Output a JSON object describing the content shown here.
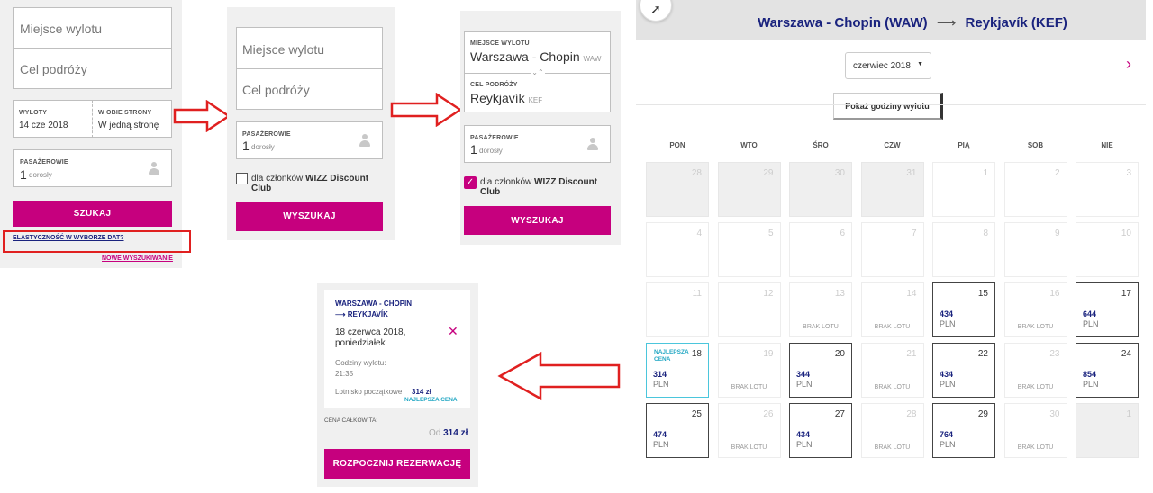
{
  "panel1": {
    "departure_placeholder": "Miejsce wylotu",
    "destination_placeholder": "Cel podróży",
    "departure_label": "WYLOTY",
    "departure_value": "14 cze 2018",
    "return_label": "W OBIE STRONY",
    "return_value": "W jedną stronę",
    "passengers_label": "PASAŻEROWIE",
    "passengers_count": "1",
    "passengers_unit": "dorosły",
    "search_button": "SZUKAJ",
    "flex_dates_link": "ELASTYCZNOŚĆ W WYBORZE DAT?",
    "new_search_link": "NOWE WYSZUKIWANIE"
  },
  "panel2": {
    "departure_placeholder": "Miejsce wylotu",
    "destination_placeholder": "Cel podróży",
    "passengers_label": "PASAŻEROWIE",
    "passengers_count": "1",
    "passengers_unit": "dorosły",
    "club_prefix": "dla członków ",
    "club_name": "WIZZ Discount Club",
    "search_button": "WYSZUKAJ"
  },
  "panel3": {
    "departure_label": "MIEJSCE WYLOTU",
    "departure_city": "Warszawa - Chopin",
    "departure_code": "WAW",
    "destination_label": "CEL PODRÓŻY",
    "destination_city": "Reykjavík",
    "destination_code": "KEF",
    "passengers_label": "PASAŻEROWIE",
    "passengers_count": "1",
    "passengers_unit": "dorosły",
    "club_prefix": "dla członków ",
    "club_name_1": "WIZZ Discount",
    "club_name_2": "Club",
    "club_checked": true,
    "search_button": "WYSZUKAJ"
  },
  "calendar": {
    "route_from": "Warszawa - Chopin (WAW)",
    "route_arrow": "⟶",
    "route_to": "Reykjavík (KEF)",
    "month_select": "czerwiec 2018",
    "show_times_button": "Pokaż godziny wylotu",
    "weekdays": [
      "PON",
      "WTO",
      "ŚRO",
      "CZW",
      "PIĄ",
      "SOB",
      "NIE"
    ],
    "no_flight": "BRAK LOTU",
    "best_price_label": "NAJLEPSZA CENA",
    "currency": "PLN",
    "days": [
      {
        "d": "28",
        "state": "past"
      },
      {
        "d": "29",
        "state": "past"
      },
      {
        "d": "30",
        "state": "past"
      },
      {
        "d": "31",
        "state": "past"
      },
      {
        "d": "1",
        "state": "off"
      },
      {
        "d": "2",
        "state": "off"
      },
      {
        "d": "3",
        "state": "off"
      },
      {
        "d": "4",
        "state": "off"
      },
      {
        "d": "5",
        "state": "off"
      },
      {
        "d": "6",
        "state": "off"
      },
      {
        "d": "7",
        "state": "off"
      },
      {
        "d": "8",
        "state": "off"
      },
      {
        "d": "9",
        "state": "off"
      },
      {
        "d": "10",
        "state": "off"
      },
      {
        "d": "11",
        "state": "off"
      },
      {
        "d": "12",
        "state": "off"
      },
      {
        "d": "13",
        "state": "nf"
      },
      {
        "d": "14",
        "state": "nf"
      },
      {
        "d": "15",
        "state": "avail",
        "price": "434"
      },
      {
        "d": "16",
        "state": "nf"
      },
      {
        "d": "17",
        "state": "avail",
        "price": "644"
      },
      {
        "d": "18",
        "state": "best",
        "price": "314"
      },
      {
        "d": "19",
        "state": "nf"
      },
      {
        "d": "20",
        "state": "avail",
        "price": "344"
      },
      {
        "d": "21",
        "state": "nf"
      },
      {
        "d": "22",
        "state": "avail",
        "price": "434"
      },
      {
        "d": "23",
        "state": "nf"
      },
      {
        "d": "24",
        "state": "avail",
        "price": "854"
      },
      {
        "d": "25",
        "state": "avail",
        "price": "474"
      },
      {
        "d": "26",
        "state": "nf"
      },
      {
        "d": "27",
        "state": "avail",
        "price": "434"
      },
      {
        "d": "28",
        "state": "nf"
      },
      {
        "d": "29",
        "state": "avail",
        "price": "764"
      },
      {
        "d": "30",
        "state": "nf"
      },
      {
        "d": "1",
        "state": "past"
      }
    ]
  },
  "summary": {
    "route_from": "WARSZAWA - CHOPIN",
    "route_to": "⟶ REYKJAVÍK",
    "date_line1": "18 czerwca 2018,",
    "date_line2": "poniedziałek",
    "time_label": "Godziny wylotu:",
    "time_value": "21:35",
    "airport_label": "Lotnisko początkowe",
    "airport_price": "314 zł",
    "best_price": "NAJLEPSZA CENA",
    "total_label": "CENA CAŁKOWITA:",
    "total_prefix": "Od",
    "total_value": "314 zł",
    "book_button": "ROZPOCZNIJ REZERWACJĘ"
  },
  "colors": {
    "brand": "#c6007e",
    "navy": "#1a237e",
    "annotation": "#e02020",
    "best": "#24a8c4"
  }
}
